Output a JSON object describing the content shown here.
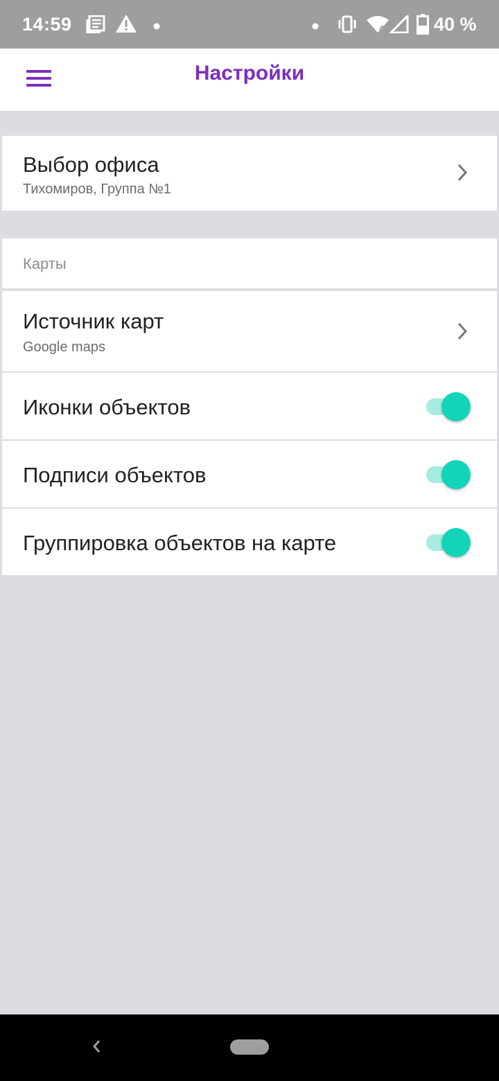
{
  "status_bar": {
    "time": "14:59",
    "battery": "40 %",
    "icons": [
      "news-icon",
      "warning-icon",
      "dot-icon",
      "dot-icon",
      "vibrate-icon",
      "wifi-icon",
      "signal-icon",
      "battery-icon"
    ]
  },
  "app_bar": {
    "title": "Настройки",
    "menu_icon": "hamburger-menu-icon",
    "title_color": "#7b2fbe"
  },
  "office": {
    "title": "Выбор офиса",
    "value": "Тихомиров, Группа №1"
  },
  "maps_section": {
    "header": "Карты",
    "source": {
      "title": "Источник карт",
      "value": "Google maps"
    },
    "toggles": [
      {
        "label": "Иконки объектов",
        "on": true
      },
      {
        "label": "Подписи объектов",
        "on": true
      },
      {
        "label": "Группировка объектов на карте",
        "on": true
      }
    ]
  },
  "colors": {
    "accent": "#7b2fbe",
    "toggle_thumb": "#12d4b9",
    "toggle_track": "#a6ece0",
    "background": "#dcdde1"
  },
  "nav_bar": {
    "back_icon": "back-chevron-icon",
    "home_icon": "home-pill-icon"
  }
}
